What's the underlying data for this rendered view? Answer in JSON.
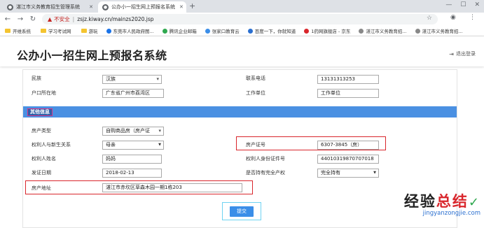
{
  "browser": {
    "tabs": [
      {
        "label": "湛江市义务教育招生管理系统",
        "active": false
      },
      {
        "label": "公办小一招生网上预报名系统",
        "active": true
      }
    ],
    "omnibox": {
      "security": "不安全",
      "url": "zsjz.kiway.cn/mainzs2020.jsp"
    },
    "bookmarks": [
      {
        "label": "开维系统",
        "type": "folder"
      },
      {
        "label": "学习考试网",
        "type": "folder"
      },
      {
        "label": "游玩",
        "type": "folder"
      },
      {
        "label": "东莞市人民政府图...",
        "type": "site"
      },
      {
        "label": "腾讯企业邮箱",
        "type": "site"
      },
      {
        "label": "张家口教育云",
        "type": "site"
      },
      {
        "label": "百度一下，你就知道",
        "type": "site"
      },
      {
        "label": "1药网旗舰店 - 京东",
        "type": "site"
      },
      {
        "label": "湛江市义务教育招...",
        "type": "site"
      },
      {
        "label": "湛江市义务教育招...",
        "type": "site"
      }
    ]
  },
  "page": {
    "title": "公办小一招生网上预报名系统",
    "logout": "退出登录"
  },
  "form": {
    "ethnicity_label": "民族",
    "ethnicity_value": "汉族",
    "phone_label": "联系电话",
    "phone_value": "13131313253",
    "hukou_label": "户口所在地",
    "hukou_value": "广东省广州市荔湾区",
    "employer_label": "工作单位",
    "employer_value": "工作单位",
    "section_title": "其他信息",
    "property_type_label": "房产类型",
    "property_type_value": "自购商品房（房产证",
    "owner_relation_label": "权利人与新生关系",
    "owner_relation_value": "母亲",
    "property_cert_label": "房产证号",
    "property_cert_value": "6307-3845（房）",
    "owner_name_label": "权利人姓名",
    "owner_name_value": "妈妈",
    "owner_id_label": "权利人身份证件号",
    "owner_id_value": "44010319870707018",
    "issue_date_label": "发证日期",
    "issue_date_value": "2018-02-13",
    "full_ownership_label": "是否持有完全产权",
    "full_ownership_value": "完全持有",
    "address_label": "房产地址",
    "address_value": "湛江市赤坎区草森木园一期1栋203",
    "submit_label": "提交"
  },
  "watermark": {
    "main_black": "经验",
    "main_red": "总结",
    "sub": "jingyanzongjie.com"
  },
  "colors": {
    "section_blue": "#4a90e2",
    "highlight_red": "#d9262c",
    "submit_blue": "#3b8ee8"
  }
}
